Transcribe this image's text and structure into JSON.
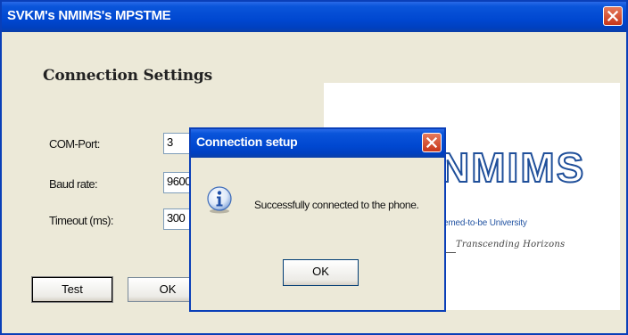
{
  "window": {
    "title": "SVKM's NMIMS's MPSTME"
  },
  "settings": {
    "heading": "Connection Settings",
    "com_port_label": "COM-Port:",
    "com_port_value": "3",
    "baud_rate_label": "Baud rate:",
    "baud_rate_value": "9600",
    "timeout_label": "Timeout (ms):",
    "timeout_value": "300"
  },
  "buttons": {
    "test": "Test",
    "ok": "OK"
  },
  "logo": {
    "name": "NMIMS",
    "subtitle": "emed-to-be University",
    "tagline": "Transcending Horizons"
  },
  "dialog": {
    "title": "Connection setup",
    "message": "Successfully connected to the phone.",
    "ok": "OK",
    "icon": "info-icon"
  },
  "colors": {
    "titlebar": "#0047D0",
    "face": "#ECE9D8",
    "close": "#C8361A",
    "brand": "#1F4F9A"
  }
}
